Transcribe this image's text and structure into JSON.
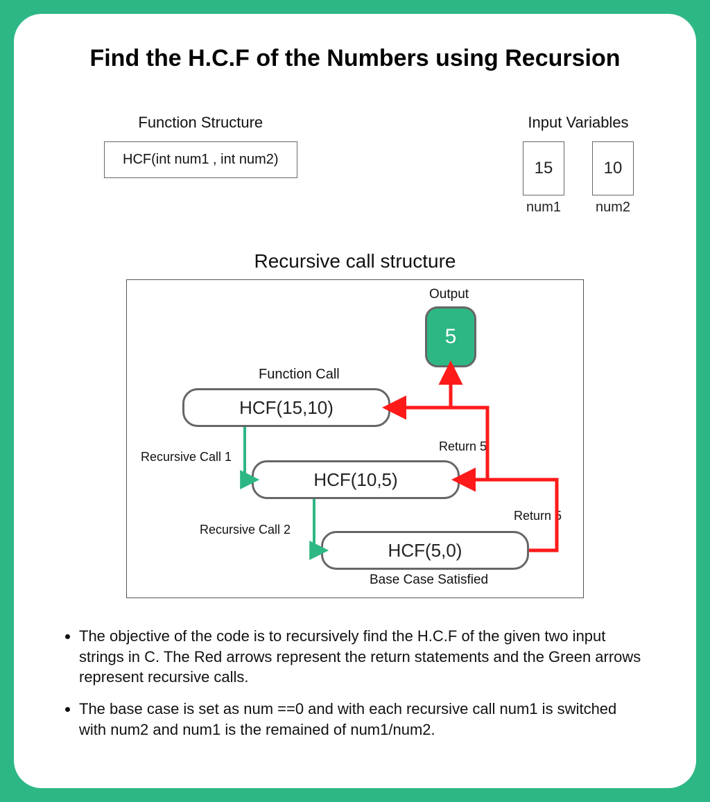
{
  "title": "Find the H.C.F of the Numbers using Recursion",
  "function_structure": {
    "label": "Function Structure",
    "signature": "HCF(int num1 , int num2)"
  },
  "input_variables": {
    "label": "Input Variables",
    "num1": {
      "value": "15",
      "name": "num1"
    },
    "num2": {
      "value": "10",
      "name": "num2"
    }
  },
  "recursive": {
    "title": "Recursive call structure",
    "output_label": "Output",
    "output_value": "5",
    "function_call_label": "Function Call",
    "call1": "HCF(15,10)",
    "call2": "HCF(10,5)",
    "call3": "HCF(5,0)",
    "rec_call1_label": "Recursive Call 1",
    "rec_call2_label": "Recursive Call 2",
    "return1_label": "Return 5",
    "return2_label": "Return 5",
    "base_case_label": "Base Case Satisfied"
  },
  "bullets": {
    "b1": "The objective of the code is to recursively find the H.C.F of the given two input strings in C. The Red arrows represent the return statements and the Green arrows represent recursive calls.",
    "b2": "The base case is set as num ==0 and with each recursive call num1 is switched with num2 and num1 is the remained of num1/num2."
  },
  "colors": {
    "accent": "#2db784",
    "return_arrow": "#ff1a1a",
    "call_arrow": "#2db784"
  }
}
